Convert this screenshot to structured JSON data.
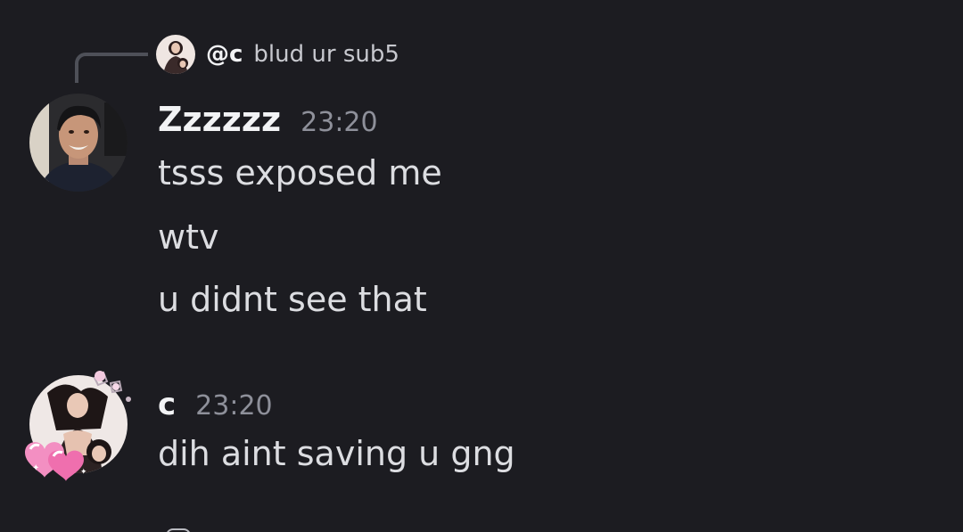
{
  "reply": {
    "author": "@c",
    "preview_text": "blud ur sub5"
  },
  "messages": [
    {
      "author": "Zzzzzz",
      "timestamp": "23:20",
      "lines": [
        "tsss exposed me",
        "wtv",
        "u didnt see that"
      ]
    },
    {
      "author": "c",
      "timestamp": "23:20",
      "lines": [
        "dih aint saving u gng"
      ]
    }
  ],
  "colors": {
    "background": "#1c1c21",
    "author": "#f2f3f5",
    "timestamp": "#8e909a",
    "message_text": "#dcdde1",
    "reply_line": "#4e5058"
  }
}
